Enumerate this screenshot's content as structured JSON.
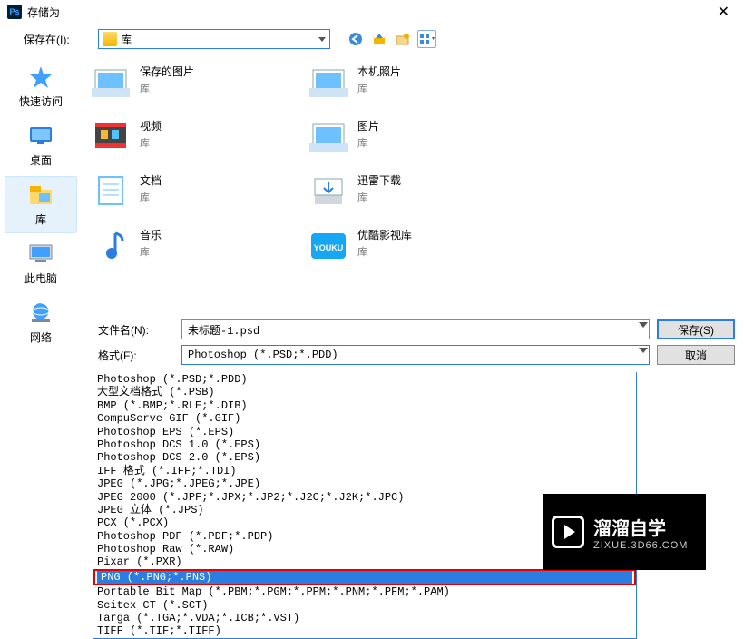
{
  "title": "存储为",
  "save_in_label": "保存在(I):",
  "location": "库",
  "sidebar": {
    "items": [
      {
        "label": "快速访问"
      },
      {
        "label": "桌面"
      },
      {
        "label": "库"
      },
      {
        "label": "此电脑"
      },
      {
        "label": "网络"
      }
    ]
  },
  "libs": [
    {
      "name": "保存的图片",
      "sub": "库"
    },
    {
      "name": "本机照片",
      "sub": "库"
    },
    {
      "name": "视频",
      "sub": "库"
    },
    {
      "name": "图片",
      "sub": "库"
    },
    {
      "name": "文档",
      "sub": "库"
    },
    {
      "name": "迅雷下载",
      "sub": "库"
    },
    {
      "name": "音乐",
      "sub": "库"
    },
    {
      "name": "优酷影视库",
      "sub": "库"
    }
  ],
  "filename_label": "文件名(N):",
  "filename_value": "未标题-1.psd",
  "format_label": "格式(F):",
  "format_selected": "Photoshop (*.PSD;*.PDD)",
  "save_btn": "保存(S)",
  "cancel_btn": "取消",
  "format_options": [
    "Photoshop (*.PSD;*.PDD)",
    "大型文档格式 (*.PSB)",
    "BMP (*.BMP;*.RLE;*.DIB)",
    "CompuServe GIF (*.GIF)",
    "Photoshop EPS (*.EPS)",
    "Photoshop DCS 1.0 (*.EPS)",
    "Photoshop DCS 2.0 (*.EPS)",
    "IFF 格式 (*.IFF;*.TDI)",
    "JPEG (*.JPG;*.JPEG;*.JPE)",
    "JPEG 2000 (*.JPF;*.JPX;*.JP2;*.J2C;*.J2K;*.JPC)",
    "JPEG 立体 (*.JPS)",
    "PCX (*.PCX)",
    "Photoshop PDF (*.PDF;*.PDP)",
    "Photoshop Raw (*.RAW)",
    "Pixar (*.PXR)",
    "PNG (*.PNG;*.PNS)",
    "Portable Bit Map (*.PBM;*.PGM;*.PPM;*.PNM;*.PFM;*.PAM)",
    "Scitex CT (*.SCT)",
    "Targa (*.TGA;*.VDA;*.ICB;*.VST)",
    "TIFF (*.TIF;*.TIFF)"
  ],
  "highlight_index": 15,
  "watermark": {
    "brand": "溜溜自学",
    "url": "ZIXUE.3D66.COM"
  }
}
